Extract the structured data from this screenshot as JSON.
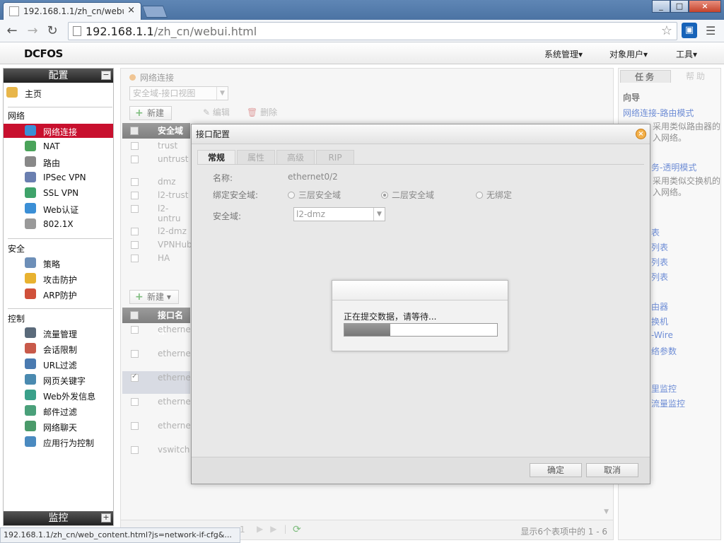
{
  "browser": {
    "tab_title": "192.168.1.1/zh_cn/webu",
    "tab_close": "×",
    "url_host": "192.168.1.1",
    "url_path": "/zh_cn/webui.html",
    "ext_label": "▣",
    "status_url": "192.168.1.1/zh_cn/web_content.html?js=network-if-cfg&..."
  },
  "app": {
    "logo": "DCFOS",
    "menus": [
      "系统管理▾",
      "对象用户▾",
      "工具▾"
    ]
  },
  "sidebar": {
    "panel_title": "配置",
    "home": "主页",
    "sections": [
      {
        "title": "网络",
        "items": [
          "网络连接",
          "NAT",
          "路由",
          "IPSec VPN",
          "SSL VPN",
          "Web认证",
          "802.1X"
        ]
      },
      {
        "title": "安全",
        "items": [
          "策略",
          "攻击防护",
          "ARP防护"
        ]
      },
      {
        "title": "控制",
        "items": [
          "流量管理",
          "会话限制",
          "URL过滤",
          "网页关键字",
          "Web外发信息",
          "邮件过滤",
          "网络聊天",
          "应用行为控制"
        ]
      }
    ],
    "monitor_title": "监控",
    "toggle_collapse": "−",
    "toggle_expand": "+"
  },
  "main": {
    "breadcrumb": "网络连接",
    "view_select": "安全域-接口视图",
    "top_actions": {
      "new": "新建",
      "edit": "编辑",
      "delete": "删除"
    },
    "zone_header": "安全域名",
    "zones": [
      "trust",
      "untrust",
      "dmz",
      "l2-trust",
      "l2-untru",
      "l2-dmz",
      "VPNHub",
      "HA"
    ],
    "iface_new": "新建",
    "iface_header": "接口名称",
    "interfaces": [
      "etherne",
      "etherne",
      "etherne",
      "etherne",
      "etherne",
      "vswitch"
    ],
    "pager_page": "1",
    "pager_info": "显示6个表项中的 1 - 6"
  },
  "taskpanel": {
    "tab_task": "任务",
    "tab_help": "帮助",
    "heading": "向导",
    "link1": "网络连接-路由模式",
    "desc1": "采用类似路由器的入网络。",
    "link2": "务-透明模式",
    "desc2": "采用类似交换机的入网络。",
    "links": [
      "表",
      "列表",
      "列表",
      "列表",
      "由器",
      "换机",
      "-Wire",
      "络参数",
      "里监控",
      "流量监控"
    ]
  },
  "dialog": {
    "title": "接口配置",
    "tabs": [
      "常规",
      "属性",
      "高级",
      "RIP"
    ],
    "name_label": "名称:",
    "name_value": "ethernet0/2",
    "bind_label": "绑定安全域:",
    "radio_l3": "三层安全域",
    "radio_l2": "二层安全域",
    "radio_none": "无绑定",
    "zone_label": "安全域:",
    "zone_value": "l2-dmz",
    "ok": "确定",
    "cancel": "取消"
  },
  "progress": {
    "message": "正在提交数据，请等待...",
    "percent": 30
  }
}
